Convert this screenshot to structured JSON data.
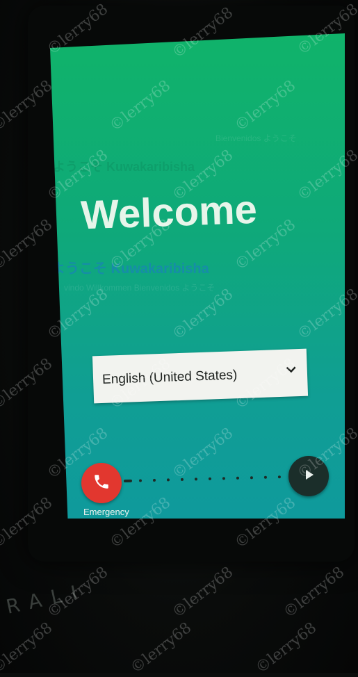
{
  "setup_screen": {
    "welcome_title": "Welcome",
    "background_welcome_fragments": {
      "line_1": "Bienvenidos ようこそ",
      "line_2": "ようこそ Kuwakaribisha",
      "line_3": "vindo Willkommen Bienvenidos ようこそ"
    },
    "language_selector": {
      "selected": "English (United States)",
      "icon": "chevron-down-icon"
    },
    "emergency_button": {
      "label": "Emergency",
      "icon": "phone-icon",
      "color": "#e2372f"
    },
    "next_button": {
      "icon": "play-arrow-icon",
      "color": "#1b2e2a"
    },
    "colors": {
      "gradient_top": "#10b36a",
      "gradient_bottom": "#0f9a9c"
    }
  },
  "photo": {
    "watermark_text": "©lerry68",
    "device_brand_text": "RALI"
  }
}
